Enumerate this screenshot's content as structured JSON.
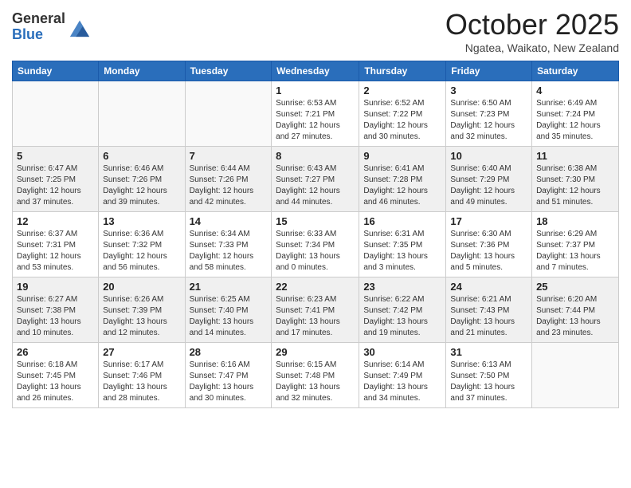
{
  "header": {
    "logo_general": "General",
    "logo_blue": "Blue",
    "month_title": "October 2025",
    "location": "Ngatea, Waikato, New Zealand"
  },
  "days_of_week": [
    "Sunday",
    "Monday",
    "Tuesday",
    "Wednesday",
    "Thursday",
    "Friday",
    "Saturday"
  ],
  "weeks": [
    [
      {
        "day": "",
        "info": ""
      },
      {
        "day": "",
        "info": ""
      },
      {
        "day": "",
        "info": ""
      },
      {
        "day": "1",
        "info": "Sunrise: 6:53 AM\nSunset: 7:21 PM\nDaylight: 12 hours and 27 minutes."
      },
      {
        "day": "2",
        "info": "Sunrise: 6:52 AM\nSunset: 7:22 PM\nDaylight: 12 hours and 30 minutes."
      },
      {
        "day": "3",
        "info": "Sunrise: 6:50 AM\nSunset: 7:23 PM\nDaylight: 12 hours and 32 minutes."
      },
      {
        "day": "4",
        "info": "Sunrise: 6:49 AM\nSunset: 7:24 PM\nDaylight: 12 hours and 35 minutes."
      }
    ],
    [
      {
        "day": "5",
        "info": "Sunrise: 6:47 AM\nSunset: 7:25 PM\nDaylight: 12 hours and 37 minutes."
      },
      {
        "day": "6",
        "info": "Sunrise: 6:46 AM\nSunset: 7:26 PM\nDaylight: 12 hours and 39 minutes."
      },
      {
        "day": "7",
        "info": "Sunrise: 6:44 AM\nSunset: 7:26 PM\nDaylight: 12 hours and 42 minutes."
      },
      {
        "day": "8",
        "info": "Sunrise: 6:43 AM\nSunset: 7:27 PM\nDaylight: 12 hours and 44 minutes."
      },
      {
        "day": "9",
        "info": "Sunrise: 6:41 AM\nSunset: 7:28 PM\nDaylight: 12 hours and 46 minutes."
      },
      {
        "day": "10",
        "info": "Sunrise: 6:40 AM\nSunset: 7:29 PM\nDaylight: 12 hours and 49 minutes."
      },
      {
        "day": "11",
        "info": "Sunrise: 6:38 AM\nSunset: 7:30 PM\nDaylight: 12 hours and 51 minutes."
      }
    ],
    [
      {
        "day": "12",
        "info": "Sunrise: 6:37 AM\nSunset: 7:31 PM\nDaylight: 12 hours and 53 minutes."
      },
      {
        "day": "13",
        "info": "Sunrise: 6:36 AM\nSunset: 7:32 PM\nDaylight: 12 hours and 56 minutes."
      },
      {
        "day": "14",
        "info": "Sunrise: 6:34 AM\nSunset: 7:33 PM\nDaylight: 12 hours and 58 minutes."
      },
      {
        "day": "15",
        "info": "Sunrise: 6:33 AM\nSunset: 7:34 PM\nDaylight: 13 hours and 0 minutes."
      },
      {
        "day": "16",
        "info": "Sunrise: 6:31 AM\nSunset: 7:35 PM\nDaylight: 13 hours and 3 minutes."
      },
      {
        "day": "17",
        "info": "Sunrise: 6:30 AM\nSunset: 7:36 PM\nDaylight: 13 hours and 5 minutes."
      },
      {
        "day": "18",
        "info": "Sunrise: 6:29 AM\nSunset: 7:37 PM\nDaylight: 13 hours and 7 minutes."
      }
    ],
    [
      {
        "day": "19",
        "info": "Sunrise: 6:27 AM\nSunset: 7:38 PM\nDaylight: 13 hours and 10 minutes."
      },
      {
        "day": "20",
        "info": "Sunrise: 6:26 AM\nSunset: 7:39 PM\nDaylight: 13 hours and 12 minutes."
      },
      {
        "day": "21",
        "info": "Sunrise: 6:25 AM\nSunset: 7:40 PM\nDaylight: 13 hours and 14 minutes."
      },
      {
        "day": "22",
        "info": "Sunrise: 6:23 AM\nSunset: 7:41 PM\nDaylight: 13 hours and 17 minutes."
      },
      {
        "day": "23",
        "info": "Sunrise: 6:22 AM\nSunset: 7:42 PM\nDaylight: 13 hours and 19 minutes."
      },
      {
        "day": "24",
        "info": "Sunrise: 6:21 AM\nSunset: 7:43 PM\nDaylight: 13 hours and 21 minutes."
      },
      {
        "day": "25",
        "info": "Sunrise: 6:20 AM\nSunset: 7:44 PM\nDaylight: 13 hours and 23 minutes."
      }
    ],
    [
      {
        "day": "26",
        "info": "Sunrise: 6:18 AM\nSunset: 7:45 PM\nDaylight: 13 hours and 26 minutes."
      },
      {
        "day": "27",
        "info": "Sunrise: 6:17 AM\nSunset: 7:46 PM\nDaylight: 13 hours and 28 minutes."
      },
      {
        "day": "28",
        "info": "Sunrise: 6:16 AM\nSunset: 7:47 PM\nDaylight: 13 hours and 30 minutes."
      },
      {
        "day": "29",
        "info": "Sunrise: 6:15 AM\nSunset: 7:48 PM\nDaylight: 13 hours and 32 minutes."
      },
      {
        "day": "30",
        "info": "Sunrise: 6:14 AM\nSunset: 7:49 PM\nDaylight: 13 hours and 34 minutes."
      },
      {
        "day": "31",
        "info": "Sunrise: 6:13 AM\nSunset: 7:50 PM\nDaylight: 13 hours and 37 minutes."
      },
      {
        "day": "",
        "info": ""
      }
    ]
  ]
}
